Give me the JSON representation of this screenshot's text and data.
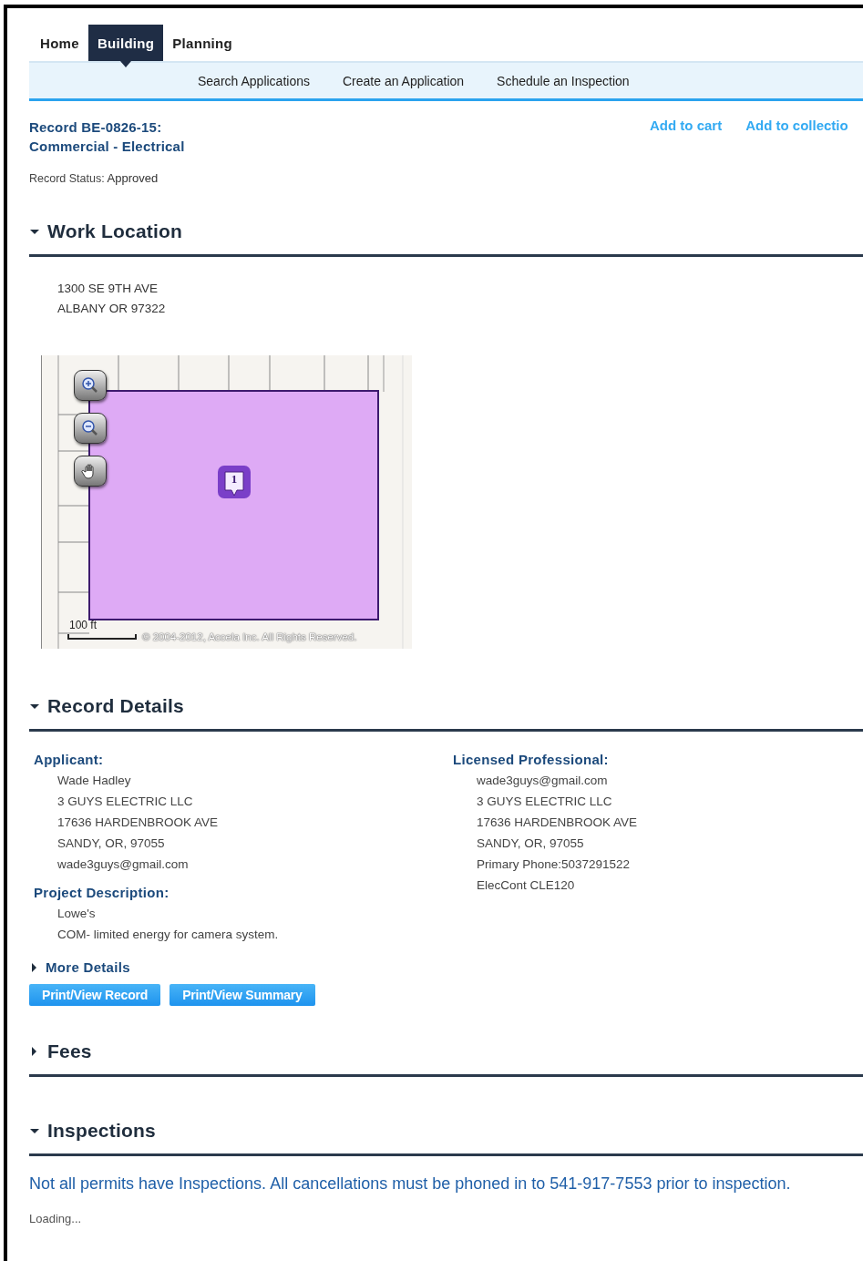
{
  "nav_tabs": [
    {
      "label": "Home",
      "selected": false
    },
    {
      "label": "Building",
      "selected": true
    },
    {
      "label": "Planning",
      "selected": false
    }
  ],
  "sub_nav": [
    "Search Applications",
    "Create an Application",
    "Schedule an Inspection"
  ],
  "record": {
    "title_lines": [
      "Record BE-0826-15:",
      "Commercial - Electrical"
    ],
    "status_label": "Record Status:",
    "status_value": "Approved"
  },
  "actions": [
    "Add to cart",
    "Add to collectio"
  ],
  "sections": [
    {
      "kind": "location",
      "title": "Work Location",
      "expanded": true,
      "address_lines": [
        "1300 SE 9TH AVE",
        "ALBANY OR 97322"
      ],
      "map": {
        "scale_label": "100 ft",
        "copyright": "© 2004-2012, Accela Inc. All Rights Reserved.",
        "marker_label": "1"
      }
    },
    {
      "kind": "details",
      "title": "Record Details",
      "expanded": true,
      "columns": [
        [
          {
            "label": "Applicant:",
            "lines": [
              "Wade Hadley",
              "3 GUYS ELECTRIC LLC",
              "17636 HARDENBROOK AVE",
              "SANDY, OR, 97055",
              "wade3guys@gmail.com"
            ]
          },
          {
            "label": "Project Description:",
            "lines": [
              "Lowe's",
              "COM- limited energy for camera system."
            ]
          }
        ],
        [
          {
            "label": "Licensed Professional:",
            "lines": [
              "wade3guys@gmail.com",
              "3 GUYS ELECTRIC LLC",
              "17636 HARDENBROOK AVE",
              "SANDY, OR, 97055",
              "Primary Phone:5037291522",
              "ElecCont CLE120"
            ]
          }
        ]
      ],
      "more_details": {
        "label": "More Details",
        "expanded": false
      },
      "buttons": [
        "Print/View Record",
        "Print/View Summary"
      ]
    },
    {
      "kind": "fees",
      "title": "Fees",
      "expanded": false
    },
    {
      "kind": "inspections",
      "title": "Inspections",
      "expanded": true,
      "notice": "Not all permits have Inspections. All cancellations must be phoned in to 541-917-7553 prior to inspection.",
      "status": "Loading..."
    }
  ]
}
